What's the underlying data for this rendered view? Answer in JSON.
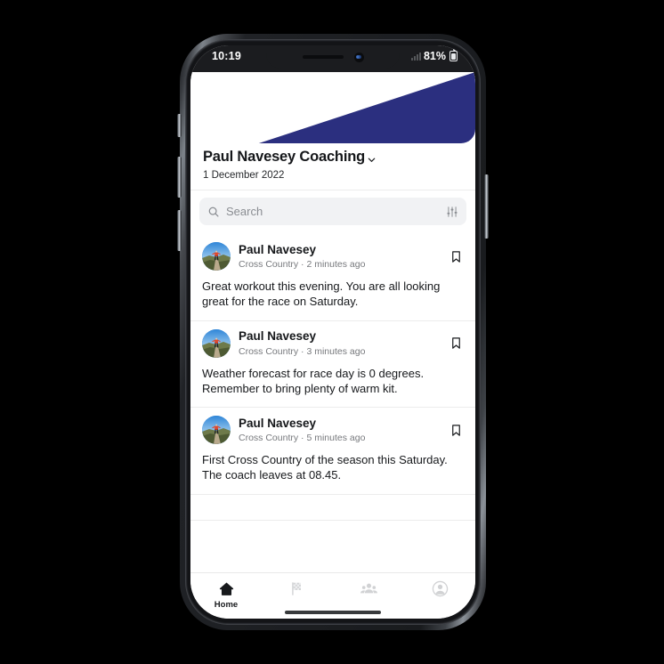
{
  "theme": {
    "brand_navy": "#2b2f7f",
    "text_primary": "#16181b",
    "text_muted": "#77797d",
    "search_bg": "#f1f2f4"
  },
  "status_bar": {
    "time": "10:19",
    "battery_percent": "81%",
    "signal_icon": "signal-bars-icon",
    "battery_icon": "battery-icon"
  },
  "header": {
    "title": "Paul Navesey Coaching",
    "dropdown_icon": "chevron-down-icon",
    "date": "1 December 2022"
  },
  "search": {
    "placeholder": "Search",
    "value": "",
    "search_icon": "search-icon",
    "filter_icon": "filter-sliders-icon"
  },
  "feed": {
    "posts": [
      {
        "author": "Paul Navesey",
        "group": "Cross Country",
        "separator": "·",
        "time": "2 minutes ago",
        "body": "Great workout this evening. You are all looking great for the race on Saturday.",
        "avatar_icon": "runner-avatar",
        "bookmark_icon": "bookmark-icon"
      },
      {
        "author": "Paul Navesey",
        "group": "Cross Country",
        "separator": "·",
        "time": "3 minutes ago",
        "body": "Weather forecast for race day is 0 degrees. Remember to bring plenty of warm kit.",
        "avatar_icon": "runner-avatar",
        "bookmark_icon": "bookmark-icon"
      },
      {
        "author": "Paul Navesey",
        "group": "Cross Country",
        "separator": "·",
        "time": "5 minutes ago",
        "body": "First Cross Country of the season this Saturday. The coach leaves at 08.45.",
        "avatar_icon": "runner-avatar",
        "bookmark_icon": "bookmark-icon"
      }
    ]
  },
  "tabbar": {
    "tabs": [
      {
        "label": "Home",
        "icon": "home-icon",
        "active": true
      },
      {
        "label": "",
        "icon": "checkered-flag-icon",
        "active": false
      },
      {
        "label": "",
        "icon": "group-people-icon",
        "active": false
      },
      {
        "label": "",
        "icon": "profile-circle-icon",
        "active": false
      }
    ]
  }
}
